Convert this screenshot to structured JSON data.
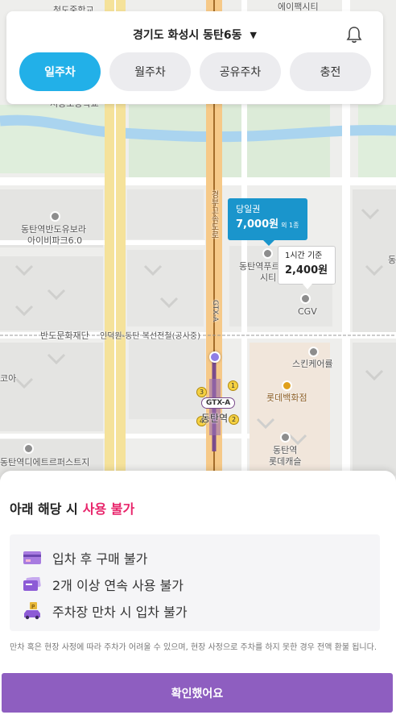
{
  "header": {
    "region": "경기도 화성시 동탄6동",
    "tabs": [
      {
        "label": "일주차",
        "active": true
      },
      {
        "label": "월주차",
        "active": false
      },
      {
        "label": "공유주차",
        "active": false
      },
      {
        "label": "충전",
        "active": false
      }
    ]
  },
  "map": {
    "labels": {
      "top_left": "청도중학교",
      "top_right": "에이팩시티",
      "school": "서동초등학교",
      "apt_left_1": "동탄역반도유보라",
      "apt_left_2": "아이비파크6.0",
      "road_vertical": "경부고속도로",
      "gtx_rail": "GTX-A",
      "foundation": "반도문화재단",
      "rail_line": "인덕원-동탄 복선전철(공사중)",
      "left_edge": "코아",
      "bottom_left": "동탄역디에트르퍼스트지",
      "station": "동탄역",
      "gtx_badge": "GTX-A",
      "skin_care": "스킨케어률",
      "lotte_dept": "롯데백화점",
      "lotte_castle_1": "동탄역",
      "lotte_castle_2": "롯데캐슬",
      "cgv": "CGV",
      "dongtan_city_1": "동탄역푸르",
      "dongtan_city_2": "시티",
      "right_edge": "동"
    },
    "exit_numbers": [
      "1",
      "2",
      "3",
      "4"
    ],
    "marker_daily": {
      "title": "당일권",
      "price": "7,000원",
      "extra": "외 1종"
    },
    "marker_hourly": {
      "title": "1시간 기준",
      "price": "2,400원"
    }
  },
  "sheet": {
    "title_prefix": "아래 해당 시",
    "title_warn": "사용 불가",
    "rules": [
      {
        "icon": "card-icon",
        "text": "입차 후 구매 불가"
      },
      {
        "icon": "ticket-icon",
        "text": "2개 이상 연속 사용 불가"
      },
      {
        "icon": "parking-car-icon",
        "text": "주차장 만차 시 입차 불가"
      }
    ],
    "notice": "만차 혹은 현장 사정에 따라 주차가 어려울 수 있으며, 현장 사정으로 주차를 하지 못한 경우 전액 환불 됩니다.",
    "confirm_label": "확인했어요"
  },
  "colors": {
    "tab_active": "#22b0e8",
    "warn": "#e8256b",
    "confirm": "#8e5ec0",
    "marker_blue": "#1a95cc"
  }
}
